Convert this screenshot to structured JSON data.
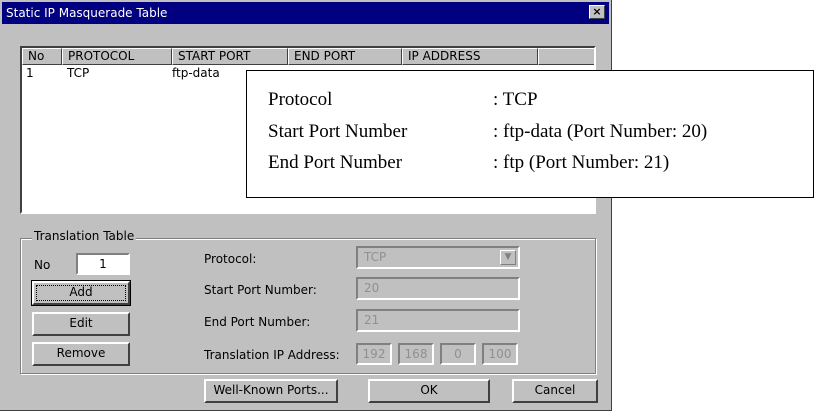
{
  "window": {
    "title": "Static IP Masquerade Table",
    "close_glyph": "×"
  },
  "list": {
    "columns": [
      "No",
      "PROTOCOL",
      "START PORT",
      "END PORT",
      "IP ADDRESS",
      ""
    ],
    "rows": [
      {
        "no": "1",
        "protocol": "TCP",
        "start_port": "ftp-data"
      }
    ]
  },
  "callout": {
    "lines": [
      {
        "label": "Protocol",
        "value": ": TCP"
      },
      {
        "label": "Start Port Number",
        "value": ": ftp-data (Port Number: 20)"
      },
      {
        "label": "End Port Number",
        "value": ": ftp (Port Number: 21)"
      }
    ]
  },
  "translation": {
    "group_title": "Translation Table",
    "no_label": "No",
    "no_value": "1",
    "add_label": "Add",
    "edit_label": "Edit",
    "remove_label": "Remove",
    "protocol_label": "Protocol:",
    "protocol_value": "TCP",
    "start_port_label": "Start Port Number:",
    "start_port_value": "20",
    "end_port_label": "End Port Number:",
    "end_port_value": "21",
    "ip_label": "Translation IP Address:",
    "ip_octets": [
      "192",
      "168",
      "0",
      "100"
    ]
  },
  "footer": {
    "well_known_label": "Well-Known Ports...",
    "ok_label": "OK",
    "cancel_label": "Cancel"
  },
  "colors": {
    "titlebar": "#000080",
    "face": "#c0c0c0",
    "disabled_text": "#909090"
  },
  "icons": {
    "close": "close-icon",
    "combo": "chevron-down-icon"
  }
}
